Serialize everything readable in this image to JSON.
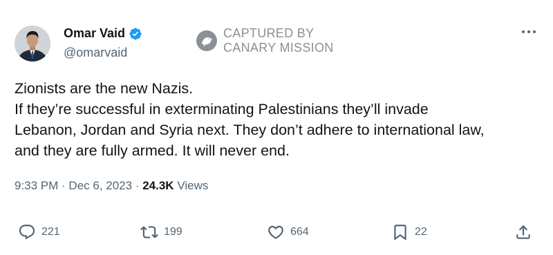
{
  "author": {
    "display_name": "Omar Vaid",
    "handle": "@omarvaid",
    "verified": true
  },
  "watermark": {
    "line1": "CAPTURED BY",
    "line2": "CANARY MISSION"
  },
  "tweet": {
    "lines": [
      "Zionists are the new Nazis.",
      "If they’re successful in exterminating Palestinians they’ll invade",
      "Lebanon, Jordan and Syria next. They don’t adhere to international law,",
      "and they are fully armed. It will never end."
    ]
  },
  "meta": {
    "time": "9:33 PM",
    "separator": " · ",
    "date": "Dec 6, 2023",
    "views_count": "24.3K",
    "views_label": " Views"
  },
  "actions": {
    "replies": "221",
    "reposts": "199",
    "likes": "664",
    "bookmarks": "22"
  },
  "icons": {
    "verified": "verified-badge-icon",
    "more": "more-options-icon",
    "reply": "reply-icon",
    "repost": "repost-icon",
    "like": "heart-icon",
    "bookmark": "bookmark-icon",
    "share": "share-icon"
  },
  "colors": {
    "verified": "#1d9bf0",
    "text_primary": "#0f1419",
    "text_secondary": "#536471",
    "watermark": "#8b9096"
  }
}
